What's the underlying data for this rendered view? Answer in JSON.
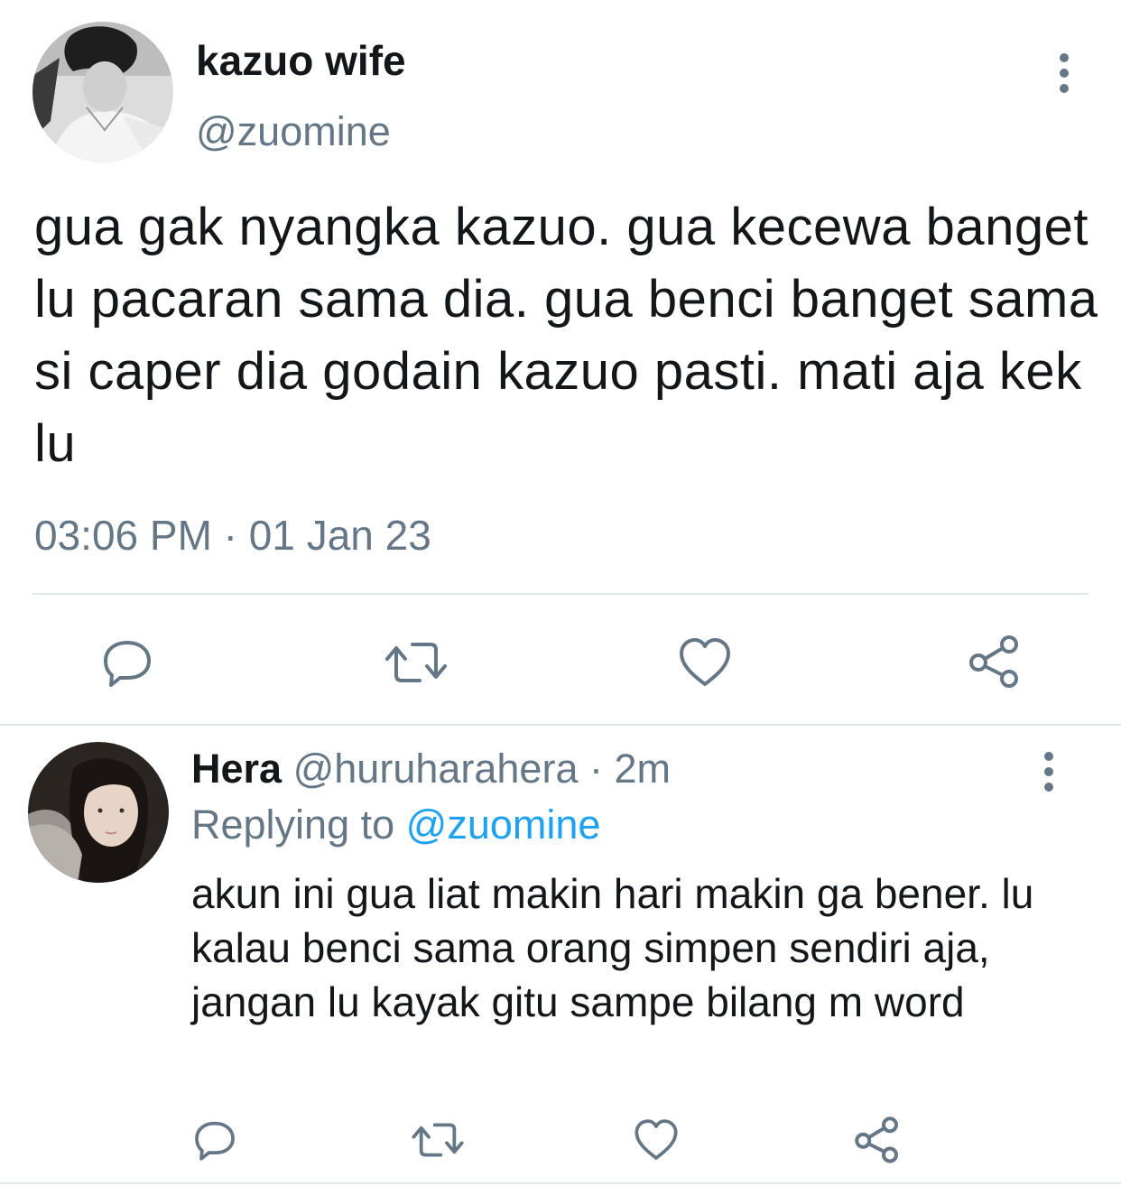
{
  "tweet": {
    "author_name": "kazuo wife",
    "author_handle": "@zuomine",
    "text": "gua gak nyangka kazuo. gua kecewa banget lu pacaran sama dia. gua benci banget sama si caper dia godain kazuo pasti. mati aja kek lu",
    "timestamp": "03:06 PM · 01 Jan 23",
    "avatar": "avatar-photo-grayscale",
    "actions": [
      "reply-icon",
      "retweet-icon",
      "like-icon",
      "share-icon"
    ]
  },
  "reply": {
    "author_name": "Hera",
    "author_handle": "@huruharahera",
    "separator": "·",
    "age": "2m",
    "replying_prefix": "Replying to",
    "replying_to": "@zuomine",
    "text": "akun ini gua liat makin hari makin ga bener. lu kalau benci sama orang simpen sendiri aja, jangan lu kayak gitu sampe bilang m word",
    "avatar": "avatar-photo",
    "actions": [
      "reply-icon",
      "retweet-icon",
      "like-icon",
      "share-icon"
    ]
  },
  "colors": {
    "text_primary": "#14171a",
    "text_secondary": "#657786",
    "link": "#1da1f2",
    "divider": "#e1e8ed"
  }
}
